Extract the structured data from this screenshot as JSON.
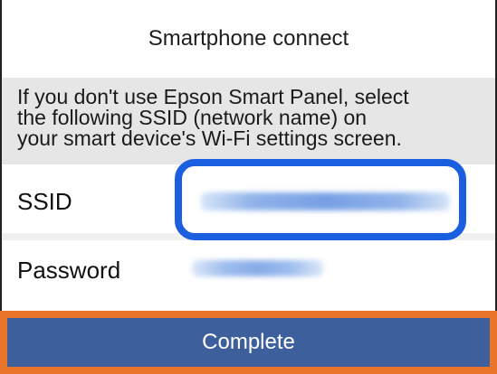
{
  "screen": {
    "title": "Smartphone connect",
    "message": "If you don't use Epson Smart Panel, select\nthe following SSID (network name) on\nyour smart device's Wi-Fi settings screen.",
    "ssid_label": "SSID",
    "password_label": "Password",
    "complete_label": "Complete"
  },
  "colors": {
    "highlight": "#1a5fe0",
    "button": "#3d5f9b",
    "focus_border": "#e8752a"
  }
}
